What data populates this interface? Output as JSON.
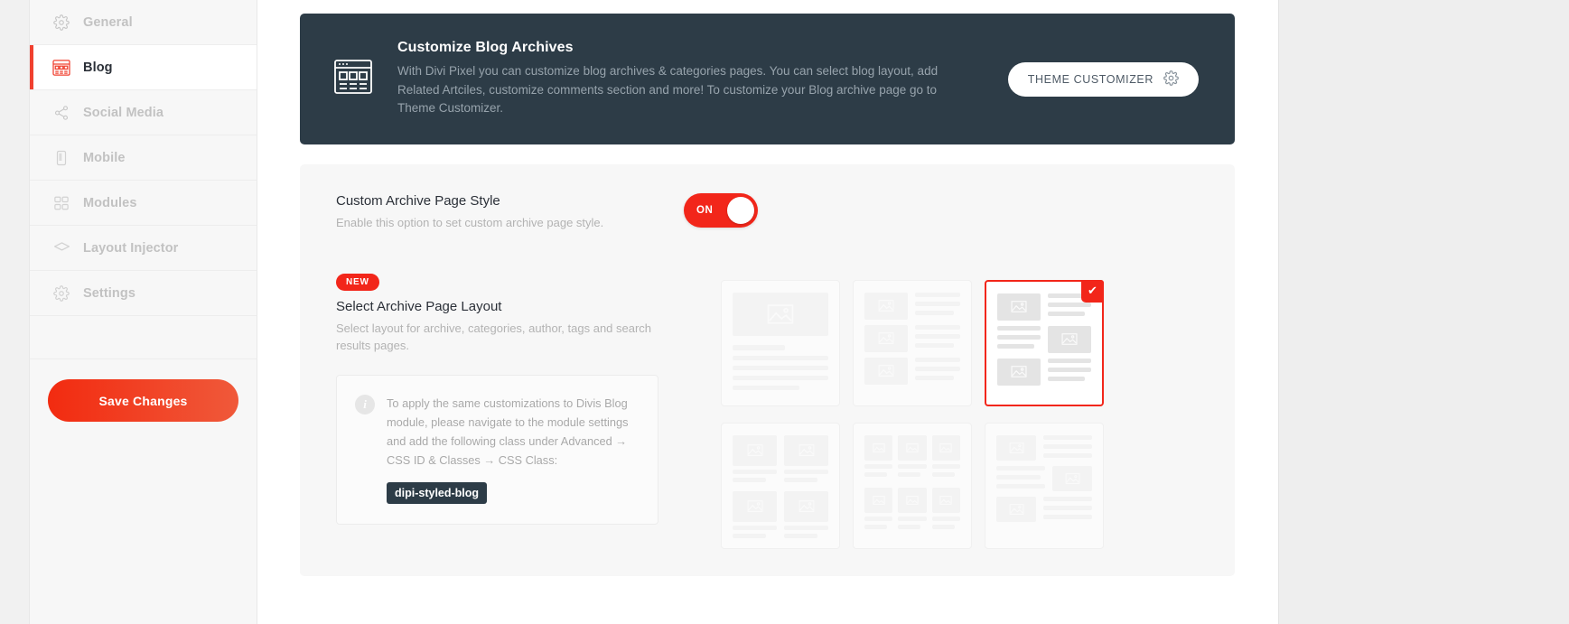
{
  "sidebar": {
    "items": [
      {
        "label": "General",
        "icon": "gear-icon",
        "active": false
      },
      {
        "label": "Blog",
        "icon": "blog-icon",
        "active": true
      },
      {
        "label": "Social Media",
        "icon": "share-icon",
        "active": false
      },
      {
        "label": "Mobile",
        "icon": "mobile-icon",
        "active": false
      },
      {
        "label": "Modules",
        "icon": "modules-icon",
        "active": false
      },
      {
        "label": "Layout Injector",
        "icon": "layers-icon",
        "active": false
      },
      {
        "label": "Settings",
        "icon": "gear-icon",
        "active": false
      }
    ],
    "save_label": "Save Changes"
  },
  "banner": {
    "icon": "browser-layout-icon",
    "title": "Customize Blog Archives",
    "description": "With Divi Pixel you can customize blog archives & categories pages. You can select blog layout, add Related Artciles, customize comments section and more! To customize your Blog archive page go to Theme Customizer.",
    "button_label": "THEME CUSTOMIZER",
    "button_icon": "gear-icon",
    "bg_color": "#2d3c47"
  },
  "options": {
    "custom_archive": {
      "title": "Custom Archive Page Style",
      "description": "Enable this option to set custom archive page style.",
      "toggle_state": "ON",
      "toggle_color": "#f2261a"
    },
    "archive_layout": {
      "badge": "NEW",
      "title": "Select Archive Page Layout",
      "description": "Select layout for archive, categories, author, tags and search results pages.",
      "info": {
        "icon": "info-icon",
        "text": "To apply the same customizations to Divis Blog module, please navigate to the module settings and add the following class under Advanced → CSS ID & Classes → CSS Class:",
        "code": "dipi-styled-blog"
      },
      "layouts": [
        {
          "name": "fullwidth-stacked",
          "selected": false
        },
        {
          "name": "list-left-image",
          "selected": false
        },
        {
          "name": "zigzag-alternating",
          "selected": true
        },
        {
          "name": "grid-two-column",
          "selected": false
        },
        {
          "name": "grid-three-column",
          "selected": false
        },
        {
          "name": "zigzag-wide",
          "selected": false
        }
      ],
      "selected_check": "✔"
    }
  },
  "accent_color": "#f2261a"
}
